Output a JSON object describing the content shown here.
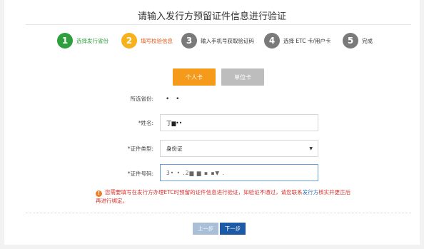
{
  "page": {
    "title": "请输入发行方预留证件信息进行验证"
  },
  "steps": [
    {
      "num": "1",
      "label": "选择发行省份",
      "color": "#2f9e3c",
      "label_color": "#2f9e3c"
    },
    {
      "num": "2",
      "label": "填写校验信息",
      "color": "#f5b21c",
      "label_color": "#e05a1a"
    },
    {
      "num": "3",
      "label": "输入手机号获取验证码",
      "color": "#7a7a7a",
      "label_color": "#333333"
    },
    {
      "num": "4",
      "label": "选择 ETC 卡/用户卡",
      "color": "#7a7a7a",
      "label_color": "#333333"
    },
    {
      "num": "5",
      "label": "完成",
      "color": "#7a7a7a",
      "label_color": "#333333"
    }
  ],
  "tabs": {
    "personal": "个人卡",
    "company": "单位卡"
  },
  "form": {
    "province_label": "所选省份:",
    "province_value": "• •",
    "name_label": "*姓名:",
    "name_value": "丁▆••",
    "id_type_label": "*证件类型:",
    "id_type_value": "身份证",
    "id_number_label": "*证件号码:",
    "id_number_value": "3• • .2▆ ▆ ▪ ▪▼ ."
  },
  "warning": {
    "text_before": "您需要填写在发行方办理ETC时预留的证件信息进行验证，如验证不通过，请您联系",
    "link": "发行方",
    "text_after": "核实并更正后再进行绑定。",
    "icon": "exclamation-circle-icon"
  },
  "buttons": {
    "prev": "上一步",
    "next": "下一步"
  },
  "colors": {
    "accent_orange": "#f59a1a",
    "primary_blue": "#1d5aa6",
    "warning_red": "#d9312b"
  }
}
